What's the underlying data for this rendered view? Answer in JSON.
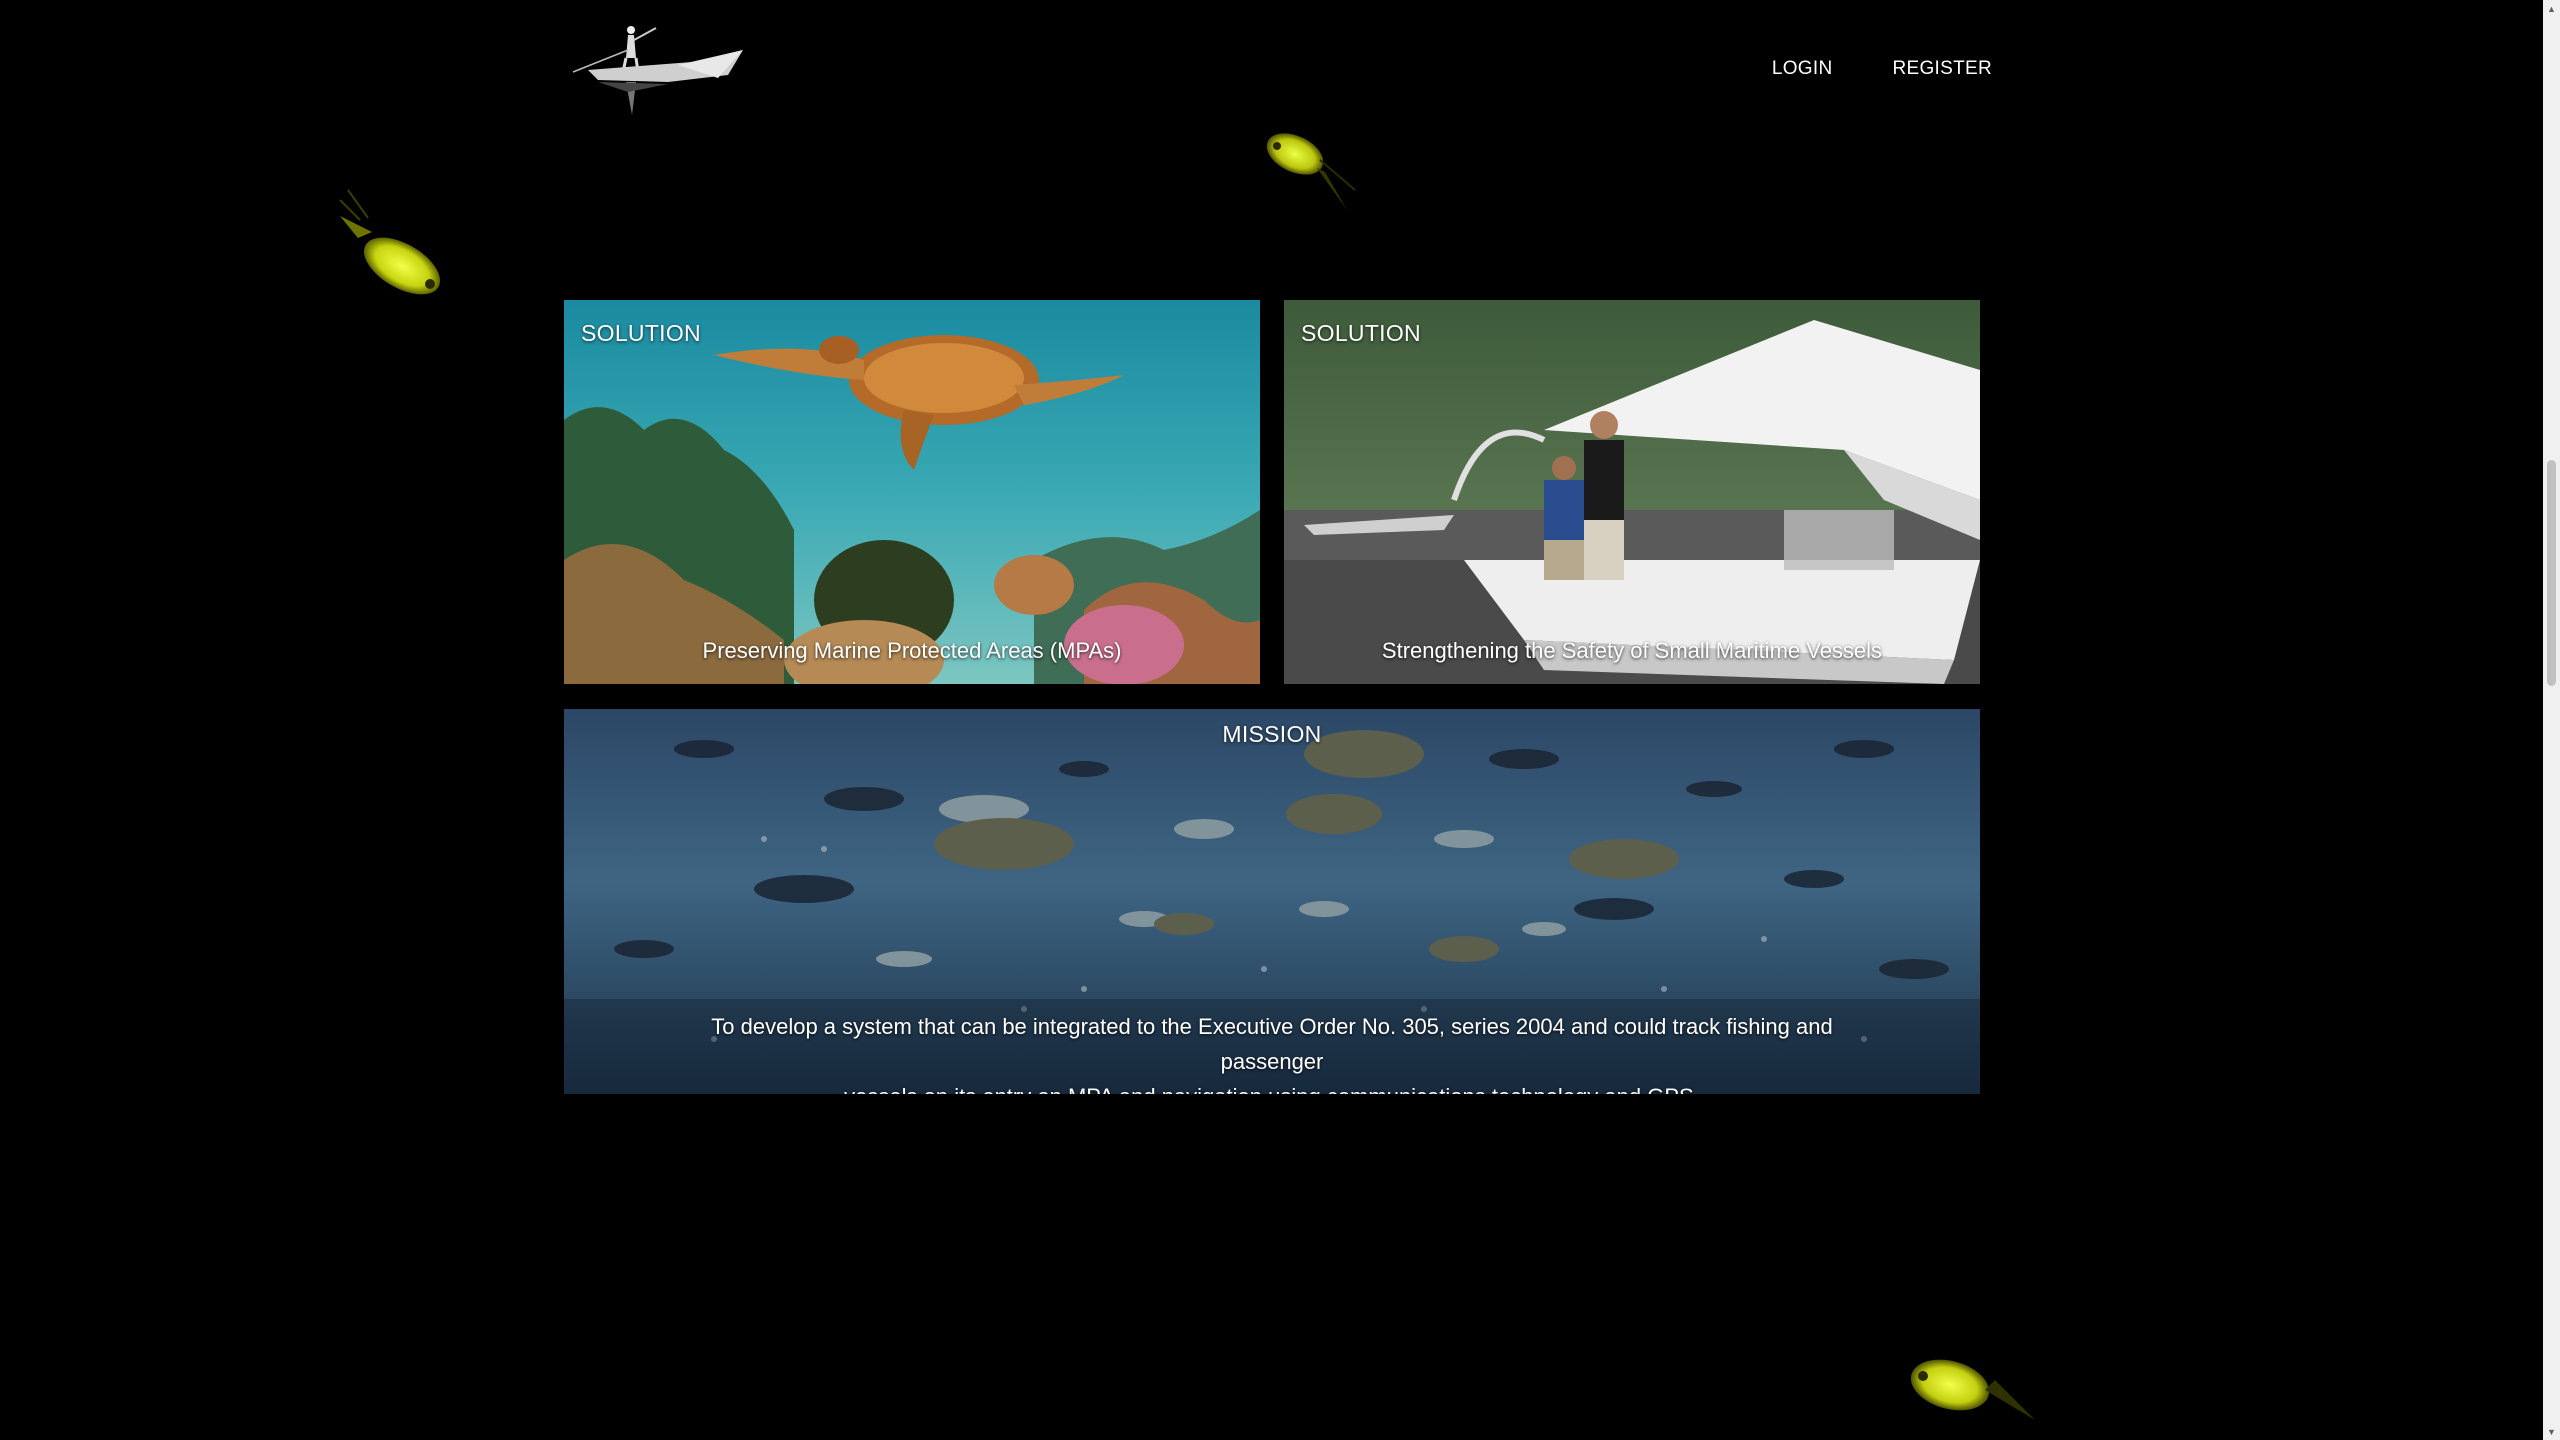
{
  "header": {
    "logo_icon": "fisherman-boat-logo-icon",
    "nav": {
      "login": "LOGIN",
      "register": "REGISTER"
    }
  },
  "cards": {
    "mpa": {
      "tag": "SOLUTION",
      "caption": "Preserving Marine Protected Areas (MPAs)"
    },
    "safety": {
      "tag": "SOLUTION",
      "caption": "Strengthening the Safety of Small Maritime Vessels"
    },
    "mission": {
      "tag": "MISSION",
      "text_line1": "To develop a system that can be integrated to the Executive Order No. 305, series 2004 and could track fishing and passenger",
      "text_line2": "vessels on its entry on MPA and navigation using communications technology and GPS."
    }
  },
  "colors": {
    "background": "#000000",
    "fish_glow": "#d9e51a"
  }
}
